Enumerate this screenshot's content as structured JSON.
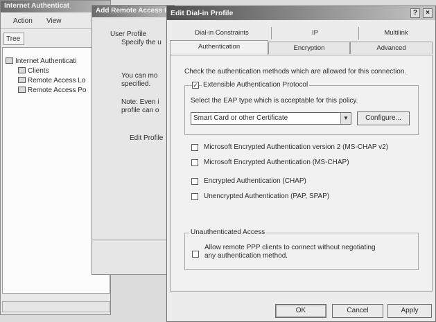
{
  "back_window": {
    "title": "Internet Authenticat",
    "menu": {
      "action": "Action",
      "view": "View"
    },
    "tree_tab": "Tree",
    "tree": [
      {
        "label": "Internet Authenticati"
      },
      {
        "label": "Clients"
      },
      {
        "label": "Remote Access Lo"
      },
      {
        "label": "Remote Access Po"
      }
    ]
  },
  "middle_window": {
    "title": "Add Remote Access Policy",
    "header_title": "User Profile",
    "header_sub": "Specify the u",
    "para1_line1": "You can mo",
    "para1_line2": "specified.",
    "para2_line1": "Note: Even i",
    "para2_line2": "profile can o",
    "edit_profile_button": "Edit Profile"
  },
  "dialog": {
    "title": "Edit Dial-in Profile",
    "help_button": "?",
    "close_button": "×",
    "tabs_top": [
      "Dial-in Constraints",
      "IP",
      "Multilink"
    ],
    "tabs_bottom": [
      "Authentication",
      "Encryption",
      "Advanced"
    ],
    "active_tab": "Authentication",
    "instruction": "Check the authentication methods which are allowed for this connection.",
    "eap": {
      "label": "Extensible Authentication Protocol",
      "checked": true,
      "select_label": "Select the EAP type which is acceptable for this policy.",
      "selected_value": "Smart Card or other Certificate",
      "configure_button": "Configure..."
    },
    "methods": [
      {
        "label": "Microsoft Encrypted Authentication version 2 (MS-CHAP v2)",
        "checked": false
      },
      {
        "label": "Microsoft Encrypted Authentication (MS-CHAP)",
        "checked": false
      },
      {
        "label": "Encrypted Authentication (CHAP)",
        "checked": false
      },
      {
        "label": "Unencrypted Authentication (PAP, SPAP)",
        "checked": false
      }
    ],
    "unauth": {
      "group_label": "Unauthenticated Access",
      "line1": "Allow remote PPP clients to connect without negotiating",
      "line2": "any authentication method.",
      "checked": false
    },
    "buttons": {
      "ok": "OK",
      "cancel": "Cancel",
      "apply": "Apply"
    }
  }
}
